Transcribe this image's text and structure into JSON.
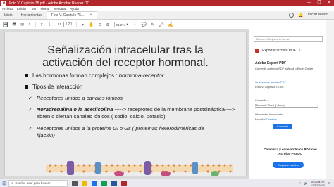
{
  "window": {
    "app_icon": "acrobat-icon",
    "title": "Foto V. Capitulo 75.pdf - Adobe Acrobat Reader DC",
    "controls": [
      "—",
      "❐",
      "✕"
    ]
  },
  "menu": [
    "Archivo",
    "Edición",
    "Ver",
    "Firmar",
    "Ventana",
    "Ayuda"
  ],
  "tabs": {
    "home": "Inicio",
    "tools": "Herramientas",
    "document": "Foto V. Capitulo 75...",
    "close": "×",
    "signin": "Iniciar sesión"
  },
  "toolbar": {
    "page_current": "15",
    "page_total": "/ 20",
    "zoom": "94,2%"
  },
  "slide": {
    "title_line1": "Señalización intracelular tras la",
    "title_line2": "activación del receptor hormonal.",
    "bullet1_prefix": "Las hormonas forman complejos : ",
    "bullet1_italic": "hormona-receptor",
    "bullet1_suffix": ".",
    "bullet2": "Tipos de interacción",
    "check1": "Receptores unidos a canales iónicos",
    "check2_bold": "Noradrenalina o la acetilcolina",
    "check2_rest": " -----> receptores de la membrana postsináptica---->",
    "check2_line2": "abren o cierran canales iónicos ( sodio, calcio, potasio)",
    "check3": "Receptores unidos a la proteína Gi o Gs ( proteínas heterodiméricas de",
    "check3_line2": "fijación)",
    "check_mark": "✓"
  },
  "right_panel": {
    "search_placeholder": "Buscar 'Dibujar una forma'",
    "export_label": "Exportar archivo PDF",
    "section_title": "Adobe Export PDF",
    "section_desc": "Convertir archivos PDF a Word o Excel Online",
    "select_file_label": "Seleccionar archivo PDF",
    "selected_file": "Foto V. Capitulo 75.pdf",
    "convert_to_label": "Convertir a",
    "convert_to_value": "Microsoft Word (*.docx)",
    "doc_language_label": "Idioma del documento:",
    "doc_language_value": "Español",
    "change_link": "Cambiar",
    "convert_button": "Convertir",
    "promo_title": "Convierta y edite archivos PDF con Acrobat Pro DC",
    "trial_button": "Empezar prueba gratuita"
  },
  "taskbar": {
    "search_placeholder": "Escribe aquí para buscar",
    "time": "10:52 a. m.",
    "date": "12/12/2020"
  },
  "colors": {
    "titlebar": "#b3262b",
    "accent_blue": "#1a73e8"
  }
}
